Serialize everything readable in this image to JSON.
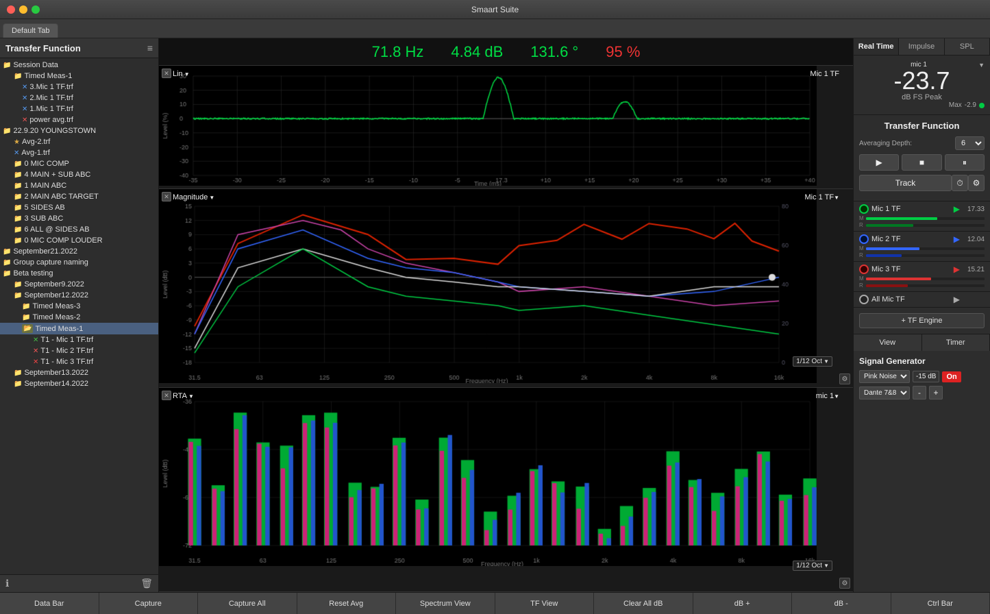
{
  "titlebar": {
    "title": "Smaart Suite",
    "buttons": [
      "close",
      "minimize",
      "maximize"
    ]
  },
  "tab": {
    "label": "Default Tab"
  },
  "sidebar": {
    "title": "Transfer Function",
    "tree": [
      {
        "id": "session-data",
        "label": "Session Data",
        "type": "folder",
        "level": 0,
        "indent": 0
      },
      {
        "id": "timed-meas-1",
        "label": "Timed Meas-1",
        "type": "folder",
        "level": 1,
        "indent": 16
      },
      {
        "id": "3mic1-trf",
        "label": "3.Mic 1 TF.trf",
        "type": "file-x-blue",
        "level": 2,
        "indent": 28
      },
      {
        "id": "2mic1-trf",
        "label": "2.Mic 1 TF.trf",
        "type": "file-x-blue",
        "level": 2,
        "indent": 28
      },
      {
        "id": "1mic1-trf",
        "label": "1.Mic 1 TF.trf",
        "type": "file-x-blue",
        "level": 2,
        "indent": 28
      },
      {
        "id": "power-avg",
        "label": "power avg.trf",
        "type": "file-x-red",
        "level": 2,
        "indent": 28
      },
      {
        "id": "youngstown",
        "label": "22.9.20 YOUNGSTOWN",
        "type": "folder",
        "level": 0,
        "indent": 0
      },
      {
        "id": "avg2",
        "label": "Avg-2.trf",
        "type": "file-star",
        "level": 1,
        "indent": 16
      },
      {
        "id": "avg1",
        "label": "Avg-1.trf",
        "type": "file-x-blue",
        "level": 1,
        "indent": 16
      },
      {
        "id": "0mic-comp",
        "label": "0 MIC COMP",
        "type": "folder",
        "level": 1,
        "indent": 16
      },
      {
        "id": "4main-sub",
        "label": "4 MAIN + SUB ABC",
        "type": "folder",
        "level": 1,
        "indent": 16
      },
      {
        "id": "1main-abc",
        "label": "1 MAIN ABC",
        "type": "folder",
        "level": 1,
        "indent": 16
      },
      {
        "id": "2main-abc-target",
        "label": "2 MAIN ABC TARGET",
        "type": "folder",
        "level": 1,
        "indent": 16
      },
      {
        "id": "5sides-ab",
        "label": "5 SIDES AB",
        "type": "folder",
        "level": 1,
        "indent": 16
      },
      {
        "id": "3sub-abc",
        "label": "3 SUB ABC",
        "type": "folder",
        "level": 1,
        "indent": 16
      },
      {
        "id": "6all-sides",
        "label": "6 ALL @ SIDES AB",
        "type": "folder",
        "level": 1,
        "indent": 16
      },
      {
        "id": "0mic-comp-louder",
        "label": "0 MIC COMP LOUDER",
        "type": "folder",
        "level": 1,
        "indent": 16
      },
      {
        "id": "sep21-2022",
        "label": "September21.2022",
        "type": "folder",
        "level": 0,
        "indent": 0
      },
      {
        "id": "group-capture",
        "label": "Group capture naming",
        "type": "folder",
        "level": 0,
        "indent": 0
      },
      {
        "id": "beta-testing",
        "label": "Beta testing",
        "type": "folder",
        "level": 0,
        "indent": 0
      },
      {
        "id": "sep9-2022",
        "label": "September9.2022",
        "type": "folder",
        "level": 1,
        "indent": 16
      },
      {
        "id": "sep12-2022",
        "label": "September12.2022",
        "type": "folder",
        "level": 1,
        "indent": 16
      },
      {
        "id": "timed-meas-3",
        "label": "Timed Meas-3",
        "type": "folder",
        "level": 2,
        "indent": 28
      },
      {
        "id": "timed-meas-2",
        "label": "Timed Meas-2",
        "type": "folder",
        "level": 2,
        "indent": 28
      },
      {
        "id": "timed-meas-1b",
        "label": "Timed Meas-1",
        "type": "folder-selected",
        "level": 2,
        "indent": 28
      },
      {
        "id": "t1-mic1",
        "label": "T1 - Mic 1 TF.trf",
        "type": "file-x-green",
        "level": 3,
        "indent": 44
      },
      {
        "id": "t1-mic2",
        "label": "T1 - Mic 2 TF.trf",
        "type": "file-x-red",
        "level": 3,
        "indent": 44
      },
      {
        "id": "t1-mic3",
        "label": "T1 - Mic 3 TF.trf",
        "type": "file-x-red2",
        "level": 3,
        "indent": 44
      },
      {
        "id": "sep13-2022",
        "label": "September13.2022",
        "type": "folder",
        "level": 1,
        "indent": 16
      },
      {
        "id": "sep14-2022",
        "label": "September14.2022",
        "type": "folder",
        "level": 1,
        "indent": 16
      }
    ]
  },
  "freq_display": {
    "hz": "71.8 Hz",
    "db": "4.84 dB",
    "deg": "131.6 °",
    "pct": "95 %"
  },
  "chart1": {
    "label": "Lin",
    "label_right": "Mic 1 TF",
    "y_axis": "Level (%)",
    "x_axis": "Time (ms)"
  },
  "chart2": {
    "label": "Magnitude",
    "label_right": "Mic 1 TF",
    "y_axis": "Level (dB)",
    "x_axis": "Frequency (Hz)",
    "oct_badge": "1/12 Oct"
  },
  "chart3": {
    "label": "RTA",
    "label_right": "mic 1",
    "y_axis": "Level (dB)",
    "x_axis": "Frequency (Hz)",
    "oct_badge": "1/12 Oct"
  },
  "right_panel": {
    "tabs": [
      "Real Time",
      "Impulse",
      "SPL"
    ],
    "active_tab": "Real Time",
    "meter": {
      "mic_label": "mic 1",
      "value": "-23.7",
      "unit": "dB FS Peak",
      "max_label": "Max",
      "max_value": "-2.9"
    },
    "tf_section": {
      "title": "Transfer Function",
      "averaging_label": "Averaging Depth:",
      "averaging_value": "6",
      "controls": [
        "play",
        "stop",
        "pause",
        "clock",
        "settings"
      ]
    },
    "track_label": "Track",
    "engines": [
      {
        "name": "Mic 1 TF",
        "color": "green",
        "value": "17.33",
        "m_fill": 60,
        "r_fill": 40
      },
      {
        "name": "Mic 2 TF",
        "color": "blue",
        "value": "12.04",
        "m_fill": 45,
        "r_fill": 30
      },
      {
        "name": "Mic 3 TF",
        "color": "red",
        "value": "15.21",
        "m_fill": 55,
        "r_fill": 35
      },
      {
        "name": "All Mic TF",
        "color": "white",
        "value": "",
        "m_fill": 0,
        "r_fill": 0
      }
    ],
    "add_tf_label": "+ TF Engine",
    "view_label": "View",
    "timer_label": "Timer",
    "sig_gen": {
      "title": "Signal Generator",
      "type": "Pink Noise",
      "level": "-15 dB",
      "on_label": "On",
      "output": "Dante 7&8",
      "minus_label": "-",
      "plus_label": "+"
    }
  },
  "toolbar": {
    "buttons": [
      "Data Bar",
      "Capture",
      "Capture All",
      "Reset Avg",
      "Spectrum View",
      "TF View",
      "Clear All dB",
      "dB +",
      "dB -",
      "Ctrl Bar"
    ]
  }
}
